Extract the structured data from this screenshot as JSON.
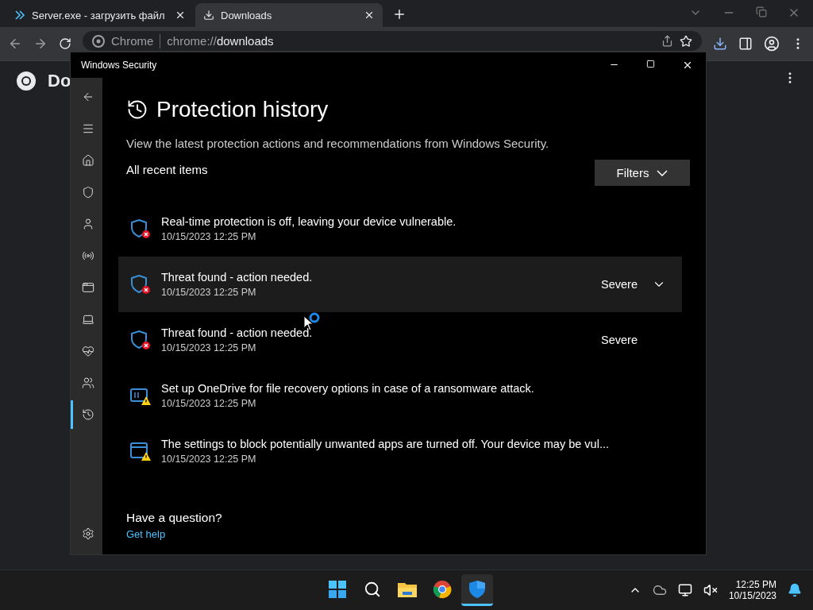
{
  "browser": {
    "tabs": [
      {
        "title": "Server.exe - загрузить файл",
        "kind": "site",
        "selected": false
      },
      {
        "title": "Downloads",
        "kind": "download",
        "selected": true
      }
    ],
    "address": {
      "site_label": "Chrome",
      "url_scheme": "chrome://",
      "url_path": "downloads"
    },
    "page_title": "Do"
  },
  "window": {
    "title": "Windows Security"
  },
  "sidebar": {
    "items": [
      {
        "kind": "back",
        "selected": false
      },
      {
        "kind": "menu",
        "selected": false
      },
      {
        "kind": "home",
        "selected": false
      },
      {
        "kind": "shield",
        "selected": false
      },
      {
        "kind": "account",
        "selected": false
      },
      {
        "kind": "network",
        "selected": false
      },
      {
        "kind": "app",
        "selected": false
      },
      {
        "kind": "device",
        "selected": false
      },
      {
        "kind": "health",
        "selected": false
      },
      {
        "kind": "family",
        "selected": false
      },
      {
        "kind": "history",
        "selected": true
      }
    ],
    "bottom": {
      "kind": "settings",
      "selected": false
    }
  },
  "content": {
    "title": "Protection history",
    "subtitle": "View the latest protection actions and recommendations from Windows Security.",
    "section": "All recent items",
    "filters_button": "Filters",
    "items": [
      {
        "kind": "shield-error",
        "text": "Real-time protection is off, leaving your device vulnerable.",
        "time": "10/15/2023 12:25 PM",
        "selected": false,
        "expandable": false
      },
      {
        "kind": "shield-error",
        "text": "Threat found - action needed.",
        "time": "10/15/2023 12:25 PM",
        "severity": "Severe",
        "selected": true,
        "expandable": true
      },
      {
        "kind": "shield-error",
        "text": "Threat found - action needed.",
        "time": "10/15/2023 12:25 PM",
        "severity": "Severe",
        "selected": false,
        "expandable": false
      },
      {
        "kind": "drive-warning",
        "text": "Set up OneDrive for file recovery options in case of a ransomware attack.",
        "time": "10/15/2023 12:25 PM",
        "selected": false,
        "expandable": false
      },
      {
        "kind": "app-warning",
        "text": "The settings to block potentially unwanted apps are turned off. Your device may be vul...",
        "time": "10/15/2023 12:25 PM",
        "selected": false,
        "expandable": false
      }
    ],
    "question": "Have a question?",
    "help_link": "Get help"
  },
  "taskbar": {
    "apps": [
      {
        "kind": "start",
        "selected": false
      },
      {
        "kind": "search",
        "selected": false
      },
      {
        "kind": "explorer",
        "selected": false
      },
      {
        "kind": "chrome",
        "selected": false
      },
      {
        "kind": "security",
        "selected": true
      }
    ],
    "time": "12:25 PM",
    "date": "10/15/2023"
  }
}
